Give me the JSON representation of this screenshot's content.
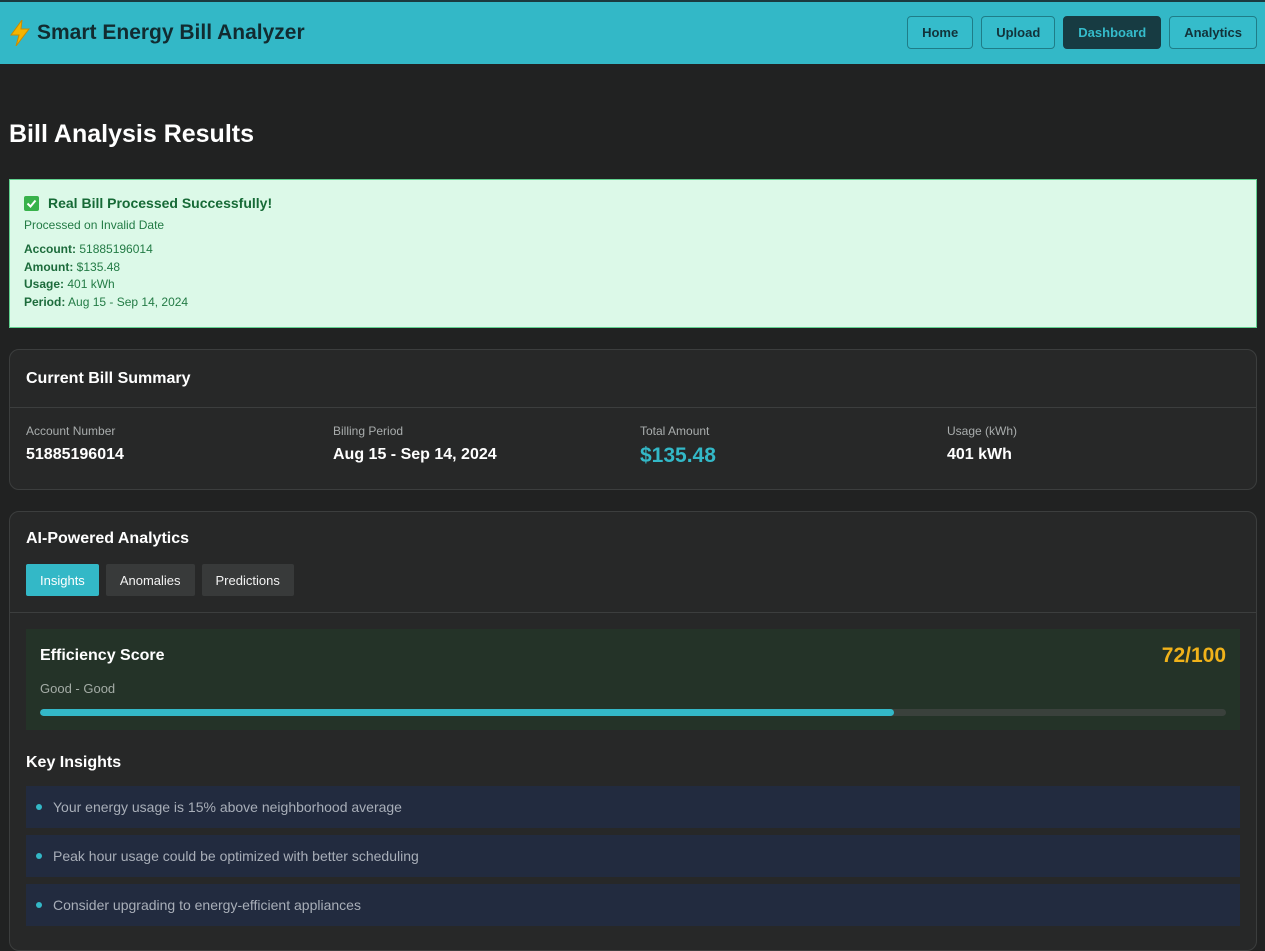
{
  "header": {
    "app_title": "Smart Energy Bill Analyzer",
    "nav": [
      {
        "label": "Home",
        "active": false
      },
      {
        "label": "Upload",
        "active": false
      },
      {
        "label": "Dashboard",
        "active": true
      },
      {
        "label": "Analytics",
        "active": false
      }
    ]
  },
  "page": {
    "title": "Bill Analysis Results"
  },
  "success": {
    "title": "Real Bill Processed Successfully!",
    "subtitle": "Processed on Invalid Date",
    "fields": [
      {
        "label": "Account:",
        "value": "51885196014"
      },
      {
        "label": "Amount:",
        "value": "$135.48"
      },
      {
        "label": "Usage:",
        "value": "401 kWh"
      },
      {
        "label": "Period:",
        "value": "Aug 15 - Sep 14, 2024"
      }
    ]
  },
  "summary": {
    "title": "Current Bill Summary",
    "items": [
      {
        "label": "Account Number",
        "value": "51885196014"
      },
      {
        "label": "Billing Period",
        "value": "Aug 15 - Sep 14, 2024"
      },
      {
        "label": "Total Amount",
        "value": "$135.48"
      },
      {
        "label": "Usage (kWh)",
        "value": "401 kWh"
      }
    ]
  },
  "analytics": {
    "title": "AI-Powered Analytics",
    "tabs": [
      {
        "label": "Insights",
        "active": true
      },
      {
        "label": "Anomalies",
        "active": false
      },
      {
        "label": "Predictions",
        "active": false
      }
    ],
    "efficiency": {
      "title": "Efficiency Score",
      "value": "72/100",
      "subtitle": "Good - Good",
      "progress_percent": 72
    },
    "key_insights_title": "Key Insights",
    "insights": [
      "Your energy usage is 15% above neighborhood average",
      "Peak hour usage could be optimized with better scheduling",
      "Consider upgrading to energy-efficient appliances"
    ]
  },
  "colors": {
    "accent": "#33b8c7",
    "score": "#f0b21a",
    "success_bg": "#dcf9e8"
  }
}
